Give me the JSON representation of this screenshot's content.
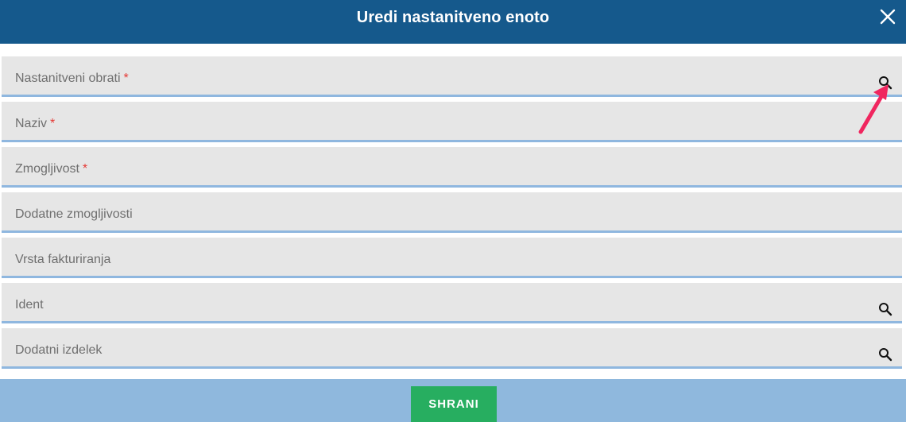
{
  "dialog": {
    "title": "Uredi nastanitveno enoto",
    "close_icon": "close-icon"
  },
  "fields": [
    {
      "label": "Nastanitveni obrati",
      "required": true,
      "required_mark": "*",
      "has_search": true
    },
    {
      "label": "Naziv",
      "required": true,
      "required_mark": "*",
      "has_search": false
    },
    {
      "label": "Zmogljivost",
      "required": true,
      "required_mark": "*",
      "has_search": false
    },
    {
      "label": "Dodatne zmogljivosti",
      "required": false,
      "required_mark": "",
      "has_search": false
    },
    {
      "label": "Vrsta fakturiranja",
      "required": false,
      "required_mark": "",
      "has_search": false
    },
    {
      "label": "Ident",
      "required": false,
      "required_mark": "",
      "has_search": true
    },
    {
      "label": "Dodatni izdelek",
      "required": false,
      "required_mark": "",
      "has_search": true
    }
  ],
  "footer": {
    "save_label": "SHRANI"
  },
  "colors": {
    "header": "#15598c",
    "field_bg": "#e6e6e6",
    "field_underline": "#8fb7df",
    "required": "#e53935",
    "footer": "#8fb8dd",
    "save_button": "#27ae60",
    "annotation_arrow": "#f0265f"
  }
}
